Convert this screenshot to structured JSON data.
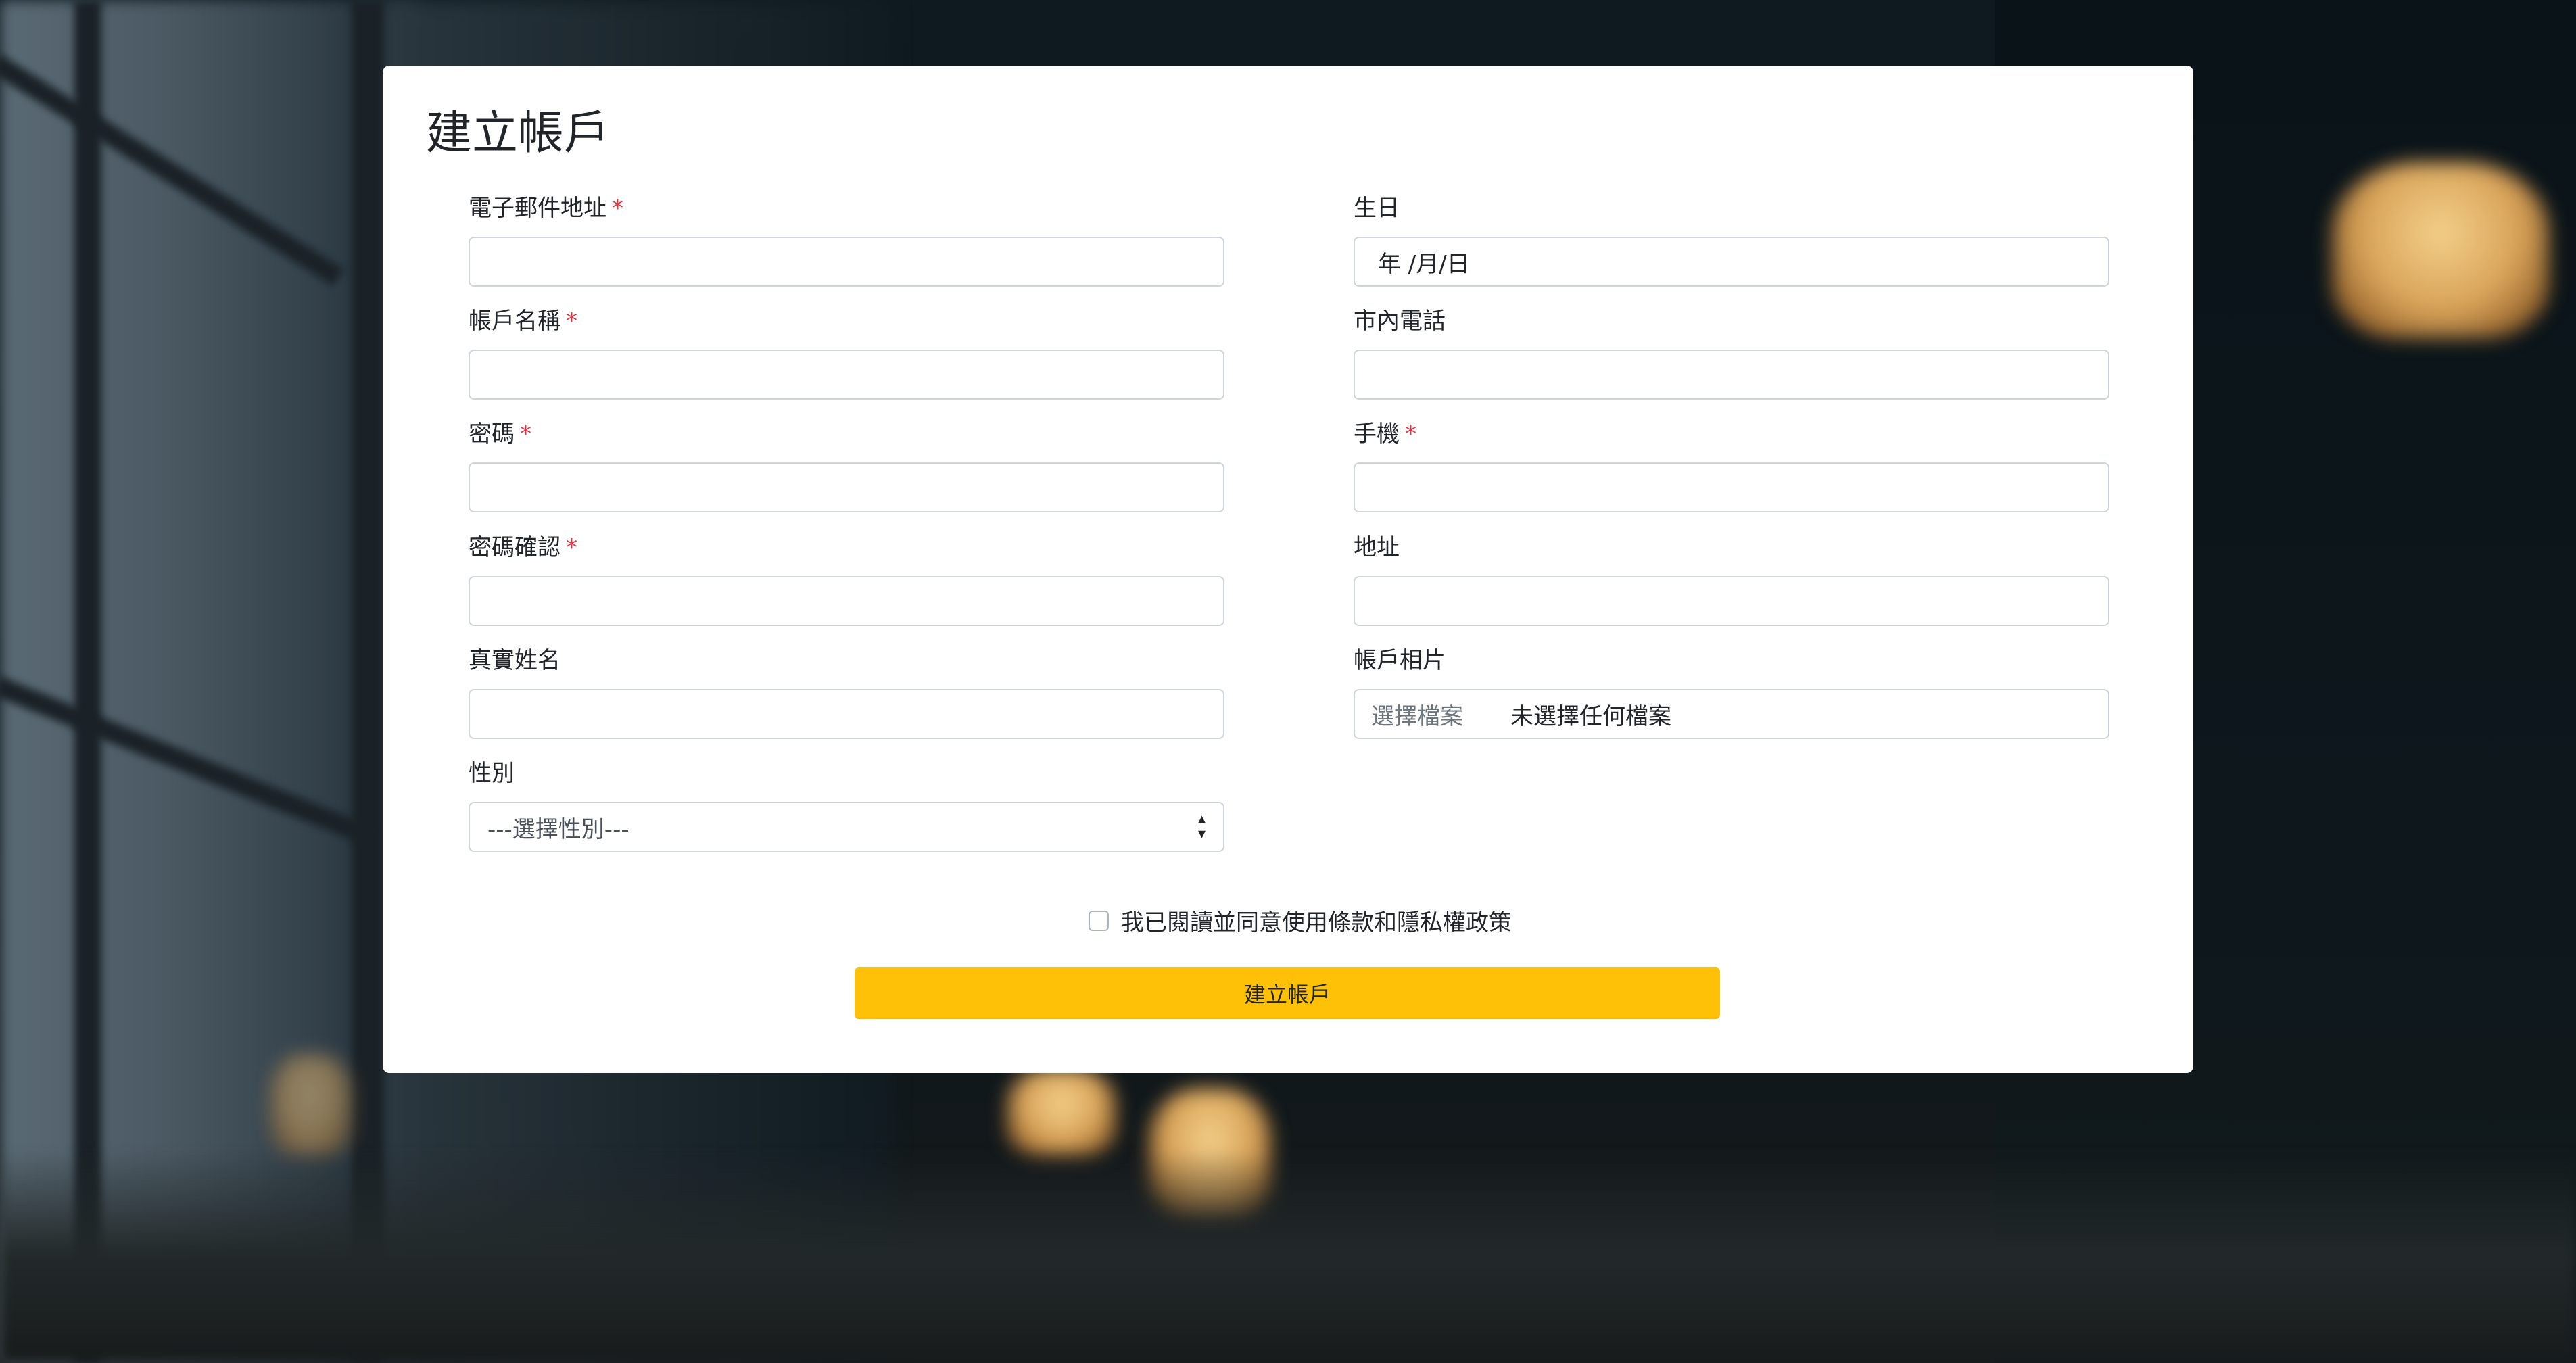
{
  "form": {
    "title": "建立帳戶",
    "required_mark": "*",
    "fields": {
      "email": {
        "label": "電子郵件地址",
        "value": ""
      },
      "account_name": {
        "label": "帳戶名稱",
        "value": ""
      },
      "password": {
        "label": "密碼",
        "value": ""
      },
      "password_confirm": {
        "label": "密碼確認",
        "value": ""
      },
      "real_name": {
        "label": "真實姓名",
        "value": ""
      },
      "gender": {
        "label": "性別",
        "selected": "---選擇性別---"
      },
      "birthday": {
        "label": "生日",
        "placeholder": "年 /月/日"
      },
      "landline": {
        "label": "市內電話",
        "value": ""
      },
      "mobile": {
        "label": "手機",
        "value": ""
      },
      "address": {
        "label": "地址",
        "value": ""
      },
      "photo": {
        "label": "帳戶相片",
        "button": "選擇檔案",
        "status": "未選擇任何檔案"
      }
    },
    "terms_label": "我已閱讀並同意使用條款和隱私權政策",
    "submit_label": "建立帳戶"
  },
  "colors": {
    "accent": "#ffc107",
    "required": "#dc3545",
    "card": "#ffffff",
    "input_border": "#ced4da"
  }
}
